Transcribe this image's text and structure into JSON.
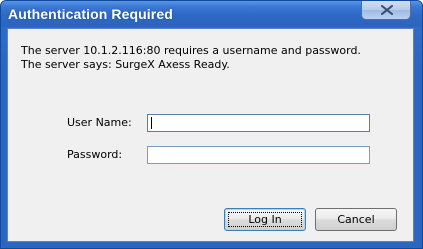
{
  "window": {
    "title": "Authentication Required",
    "close_glyph": "X",
    "close_icon": "close-icon"
  },
  "message": {
    "line1": "The server 10.1.2.116:80 requires a username and password.",
    "line2": "The server says: SurgeX Axess Ready."
  },
  "form": {
    "username_label": "User Name:",
    "username_value": "",
    "password_label": "Password:",
    "password_value": ""
  },
  "buttons": {
    "login_label": "Log In",
    "cancel_label": "Cancel"
  },
  "colors": {
    "titlebar": "#2f6cc8",
    "client_bg": "#f0f0f0",
    "input_border": "#7f9db9"
  }
}
